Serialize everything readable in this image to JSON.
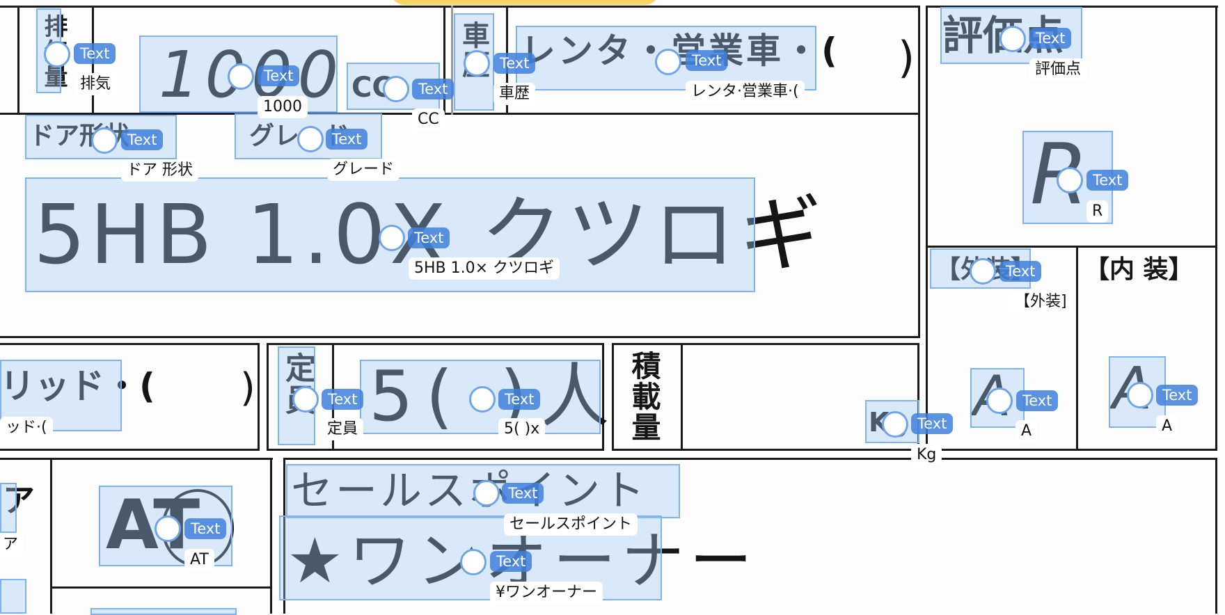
{
  "document": {
    "type": "vehicle spec form (scanned, handwritten)",
    "fields": {
      "displacement_label": "排気量",
      "displacement_value": "1000",
      "displacement_unit": "CC",
      "history_label": "車歴",
      "history_value": "レンタ・営業車・(",
      "history_close": ")",
      "door_label": "ドア形状",
      "grade_label": "グレード",
      "grade_value": "5HB 1.0X クツロギ",
      "hybrid_partial": "リッド・(",
      "hybrid_close": ")",
      "capacity_label": "定員",
      "capacity_value": "5(  )人",
      "load_label": "積載量",
      "load_unit": "Kg",
      "rating_label": "評価点",
      "rating_value": "R",
      "exterior_label": "【外装】",
      "exterior_value": "A",
      "interior_label": "【内 装】",
      "interior_value": "A",
      "transmission_value": "AT",
      "left_partial": "ア",
      "salespoint_label": "セールスポイント",
      "salespoint_value": "★ワンオーナー"
    }
  },
  "ocr": {
    "tag_text": "Text",
    "annotations": [
      {
        "id": "haiki",
        "text": "排気"
      },
      {
        "id": "1000",
        "text": "1000"
      },
      {
        "id": "cc",
        "text": "CC"
      },
      {
        "id": "shareki",
        "text": "車歴"
      },
      {
        "id": "renta",
        "text": "レンタ·営業車·("
      },
      {
        "id": "hyoka",
        "text": "評価点"
      },
      {
        "id": "door",
        "text": "ドア 形状"
      },
      {
        "id": "grade",
        "text": "グレード"
      },
      {
        "id": "r",
        "text": "R"
      },
      {
        "id": "model",
        "text": "5HB 1.0× クツロギ"
      },
      {
        "id": "gaiso",
        "text": "【外装]"
      },
      {
        "id": "hybrid",
        "text": "ッド·("
      },
      {
        "id": "teiin",
        "text": "定員"
      },
      {
        "id": "five",
        "text": "5( )x"
      },
      {
        "id": "kg",
        "text": "Kg"
      },
      {
        "id": "a1",
        "text": "A"
      },
      {
        "id": "a2",
        "text": "A"
      },
      {
        "id": "a_left",
        "text": "ア"
      },
      {
        "id": "at",
        "text": "AT"
      },
      {
        "id": "sales",
        "text": "セールスポイント"
      },
      {
        "id": "oneowner",
        "text": "¥ワンオーナー"
      }
    ]
  },
  "colors": {
    "box_fill": "#a0c8f5",
    "box_border": "#7fb2ee",
    "tag_bg": "#4080dc",
    "banner": "#f8d464"
  }
}
